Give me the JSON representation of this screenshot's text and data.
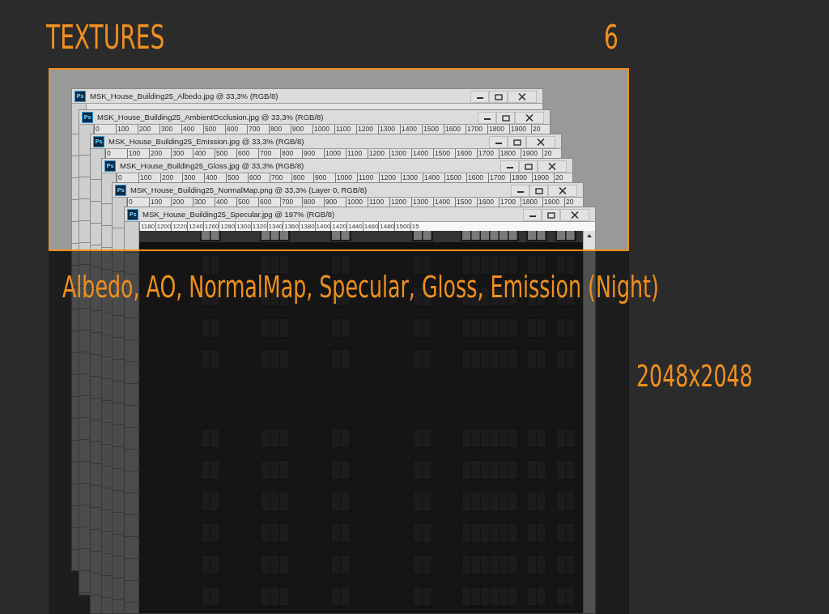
{
  "header": {
    "title": "TEXTURES",
    "count": "6"
  },
  "windows": [
    {
      "kind": "overview",
      "icon_text": "Ps",
      "title": "MSK_House_Building25_Albedo.jpg @ 33,3% (RGB/8)"
    },
    {
      "kind": "overview",
      "icon_text": "Ps",
      "title": "MSK_House_Building25_AmbientOcclusion.jpg @ 33,3% (RGB/8)",
      "ruler_labels": [
        "0",
        "100",
        "200",
        "300",
        "400",
        "500",
        "600",
        "700",
        "800",
        "900",
        "1000",
        "1100",
        "1200",
        "1300",
        "1400",
        "1500",
        "1600",
        "1700",
        "1800",
        "1900",
        "20"
      ]
    },
    {
      "kind": "overview",
      "icon_text": "Ps",
      "title": "MSK_House_Building25_Emission.jpg @ 33,3% (RGB/8)",
      "ruler_labels": [
        "0",
        "100",
        "200",
        "300",
        "400",
        "500",
        "600",
        "700",
        "800",
        "900",
        "1000",
        "1100",
        "1200",
        "1300",
        "1400",
        "1500",
        "1600",
        "1700",
        "1800",
        "1900",
        "20"
      ]
    },
    {
      "kind": "overview",
      "icon_text": "Ps",
      "title": "MSK_House_Building25_Gloss.jpg @ 33,3% (RGB/8)",
      "ruler_labels": [
        "0",
        "100",
        "200",
        "300",
        "400",
        "500",
        "600",
        "700",
        "800",
        "900",
        "1000",
        "1100",
        "1200",
        "1300",
        "1400",
        "1500",
        "1600",
        "1700",
        "1800",
        "1900",
        "20"
      ]
    },
    {
      "kind": "overview",
      "icon_text": "Ps",
      "title": "MSK_House_Building25_NormalMap.png @ 33,3% (Layer 0, RGB/8)",
      "ruler_labels": [
        "0",
        "100",
        "200",
        "300",
        "400",
        "500",
        "600",
        "700",
        "800",
        "900",
        "1000",
        "1100",
        "1200",
        "1300",
        "1400",
        "1500",
        "1600",
        "1700",
        "1800",
        "1900",
        "20"
      ]
    },
    {
      "kind": "zoomed",
      "icon_text": "Ps",
      "title": "MSK_House_Building25_Specular.jpg @ 197% (RGB/8)",
      "ruler_labels": [
        "1180",
        "1200",
        "1220",
        "1240",
        "1260",
        "1280",
        "1300",
        "1320",
        "1340",
        "1360",
        "1380",
        "1400",
        "1420",
        "1440",
        "1460",
        "1480",
        "1500",
        "15"
      ]
    }
  ],
  "caption": "Albedo, AO, NormalMap, Specular, Gloss, Emission (Night)",
  "resolution": "2048x2048"
}
